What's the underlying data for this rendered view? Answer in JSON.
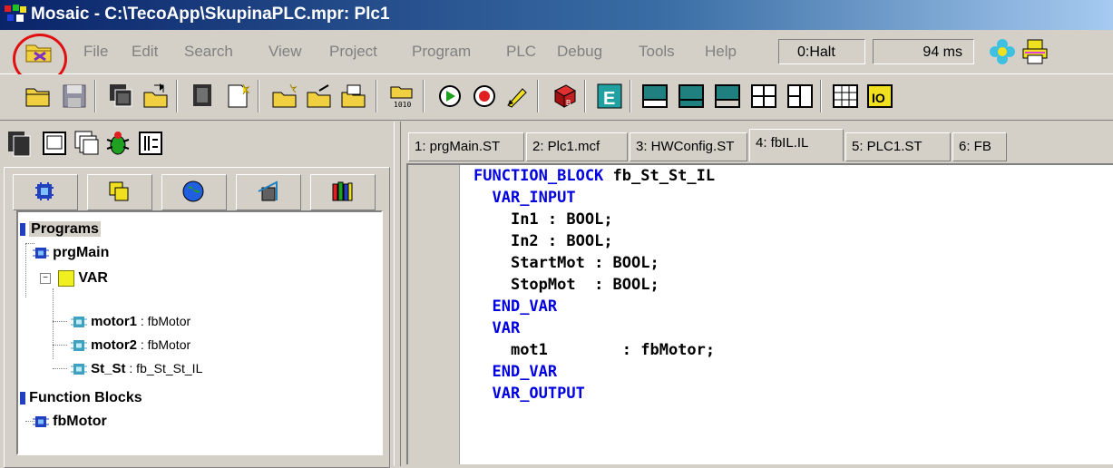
{
  "window": {
    "title": "Mosaic - C:\\TecoApp\\SkupinaPLC.mpr: Plc1"
  },
  "menu": [
    "File",
    "Edit",
    "Search",
    "View",
    "Project",
    "Program",
    "PLC",
    "Debug",
    "Tools",
    "Help"
  ],
  "status": {
    "mode": "0:Halt",
    "cycle": "94 ms"
  },
  "colors": {
    "accent": "#0a246a",
    "keyword": "#0000e0",
    "highlight_circle": "#e01010"
  },
  "toolbar_icons": [
    "open-project-icon",
    "save-icon",
    "windows-icon",
    "open-file-icon",
    "window-copy-icon",
    "new-file-icon",
    "new-doc-icon",
    "export-doc-icon",
    "doc-properties-icon",
    "compile-icon",
    "run-icon",
    "stop-icon",
    "edit-tool-icon",
    "build-icon",
    "editor-e-icon",
    "layout-1-icon",
    "layout-2-icon",
    "layout-3-icon",
    "layout-4-icon",
    "layout-5-icon",
    "grid-icon",
    "io-icon"
  ],
  "left_tabs": [
    "program-tab-icon",
    "layers-tab-icon",
    "globe-tab-icon",
    "network-tab-icon",
    "library-tab-icon"
  ],
  "tree": {
    "programs": "Programs",
    "prgmain": "prgMain",
    "var": "VAR",
    "motor1": "motor1",
    "motor1_type": " : fbMotor",
    "motor2": "motor2",
    "motor2_type": " : fbMotor",
    "stst": "St_St",
    "stst_type": " : fb_St_St_IL",
    "function_blocks": "Function Blocks",
    "fbmotor": "fbMotor"
  },
  "editor_tabs": [
    "1: prgMain.ST",
    "2: Plc1.mcf",
    "3: HWConfig.ST",
    "4: fbIL.IL",
    "5: PLC1.ST",
    "6: FB"
  ],
  "code": [
    {
      "kw": "FUNCTION_BLOCK",
      "rest": " fb_St_St_IL",
      "indent": ""
    },
    {
      "kw": "VAR_INPUT",
      "rest": "",
      "indent": "  "
    },
    {
      "kw": "",
      "rest": "In1 : ",
      "dt": "BOOL",
      "end": ";",
      "indent": "    "
    },
    {
      "kw": "",
      "rest": "In2 : ",
      "dt": "BOOL",
      "end": ";",
      "indent": "    "
    },
    {
      "kw": "",
      "rest": "StartMot : ",
      "dt": "BOOL",
      "end": ";",
      "indent": "    "
    },
    {
      "kw": "",
      "rest": "StopMot  : ",
      "dt": "BOOL",
      "end": ";",
      "indent": "    "
    },
    {
      "kw": "END_VAR",
      "rest": "",
      "indent": "  "
    },
    {
      "kw": "VAR",
      "rest": "",
      "indent": "  "
    },
    {
      "kw": "",
      "rest": "mot1        : fbMotor;",
      "indent": "    "
    },
    {
      "kw": "END_VAR",
      "rest": "",
      "indent": "  "
    },
    {
      "kw": "VAR_OUTPUT",
      "rest": "",
      "indent": "  "
    }
  ]
}
